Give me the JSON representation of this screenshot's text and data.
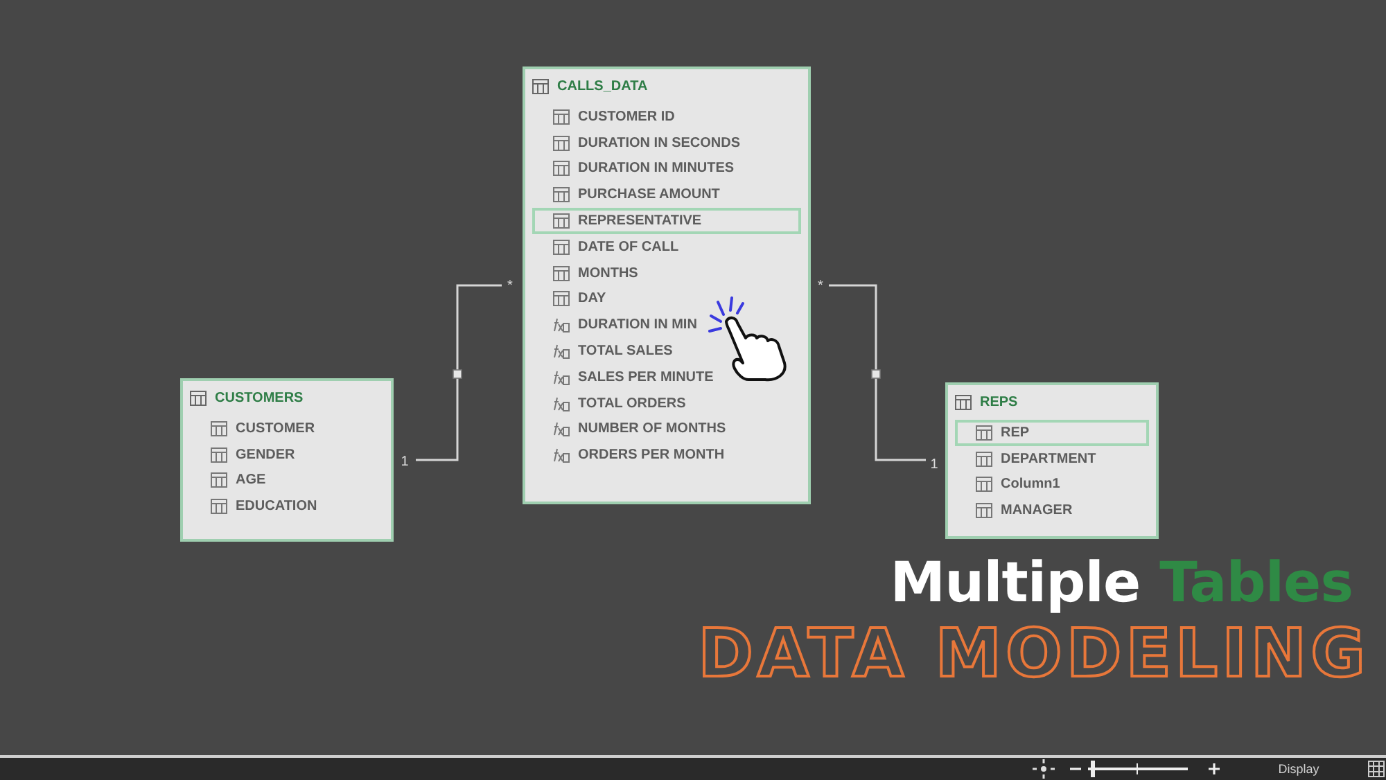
{
  "tables": [
    {
      "name": "CUSTOMERS",
      "fields": [
        {
          "label": "CUSTOMER",
          "kind": "column",
          "selected": false
        },
        {
          "label": "GENDER",
          "kind": "column",
          "selected": false
        },
        {
          "label": "AGE",
          "kind": "column",
          "selected": false
        },
        {
          "label": "EDUCATION",
          "kind": "column",
          "selected": false
        }
      ]
    },
    {
      "name": "CALLS_DATA",
      "fields": [
        {
          "label": "CUSTOMER ID",
          "kind": "column",
          "selected": false
        },
        {
          "label": "DURATION IN SECONDS",
          "kind": "column",
          "selected": false
        },
        {
          "label": "DURATION IN MINUTES",
          "kind": "column",
          "selected": false
        },
        {
          "label": "PURCHASE AMOUNT",
          "kind": "column",
          "selected": false
        },
        {
          "label": "REPRESENTATIVE",
          "kind": "column",
          "selected": true
        },
        {
          "label": "DATE OF CALL",
          "kind": "column",
          "selected": false
        },
        {
          "label": "MONTHS",
          "kind": "column",
          "selected": false
        },
        {
          "label": "DAY",
          "kind": "column",
          "selected": false
        },
        {
          "label": "DURATION IN MIN",
          "kind": "measure",
          "selected": false
        },
        {
          "label": "TOTAL SALES",
          "kind": "measure",
          "selected": false
        },
        {
          "label": "SALES PER MINUTE",
          "kind": "measure",
          "selected": false
        },
        {
          "label": "TOTAL ORDERS",
          "kind": "measure",
          "selected": false
        },
        {
          "label": "NUMBER OF MONTHS",
          "kind": "measure",
          "selected": false
        },
        {
          "label": "ORDERS PER MONTH",
          "kind": "measure",
          "selected": false
        }
      ]
    },
    {
      "name": "REPS",
      "fields": [
        {
          "label": "REP",
          "kind": "column",
          "selected": true
        },
        {
          "label": "DEPARTMENT",
          "kind": "column",
          "selected": false
        },
        {
          "label": "Column1",
          "kind": "column",
          "selected": false
        },
        {
          "label": "MANAGER",
          "kind": "column",
          "selected": false
        }
      ]
    }
  ],
  "relationships": [
    {
      "many_end": "*",
      "one_end": "1"
    },
    {
      "many_end": "*",
      "one_end": "1"
    }
  ],
  "headline": {
    "words": [
      {
        "text": "Multiple",
        "color": "#ffffff"
      },
      {
        "text": "Tables",
        "color": "#2f8a45"
      }
    ],
    "subtitle": "DATA MODELING"
  },
  "status_bar": {
    "zoom": {
      "level": 0.03
    },
    "display_label": "Display"
  }
}
